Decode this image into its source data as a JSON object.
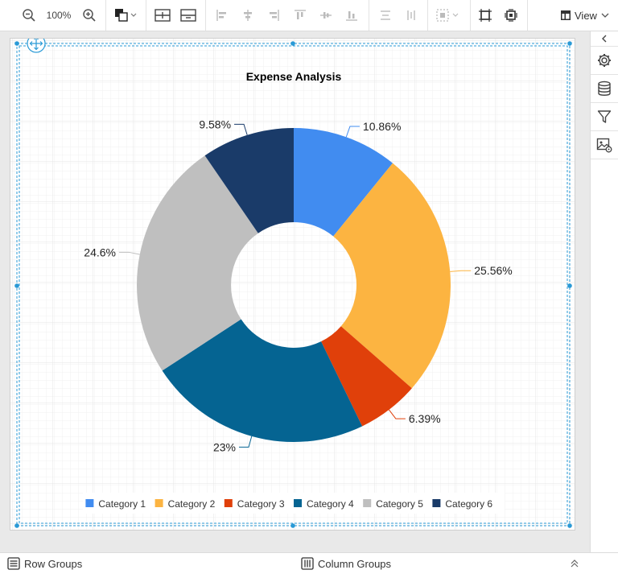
{
  "toolbar": {
    "zoom_level": "100%",
    "view_label": "View"
  },
  "chart_data": {
    "type": "pie",
    "variant": "doughnut",
    "title": "Expense Analysis",
    "categories": [
      "Category 1",
      "Category 2",
      "Category 3",
      "Category 4",
      "Category 5",
      "Category 6"
    ],
    "values": [
      10.86,
      25.56,
      6.39,
      23,
      24.6,
      9.58
    ],
    "labels": [
      "10.86%",
      "25.56%",
      "6.39%",
      "23%",
      "24.6%",
      "9.58%"
    ],
    "colors": [
      "#418cf0",
      "#fcb441",
      "#e0400a",
      "#056492",
      "#bfbfbf",
      "#1a3b69"
    ],
    "legend_position": "bottom"
  },
  "bottom_bar": {
    "row_groups": "Row Groups",
    "column_groups": "Column Groups"
  }
}
